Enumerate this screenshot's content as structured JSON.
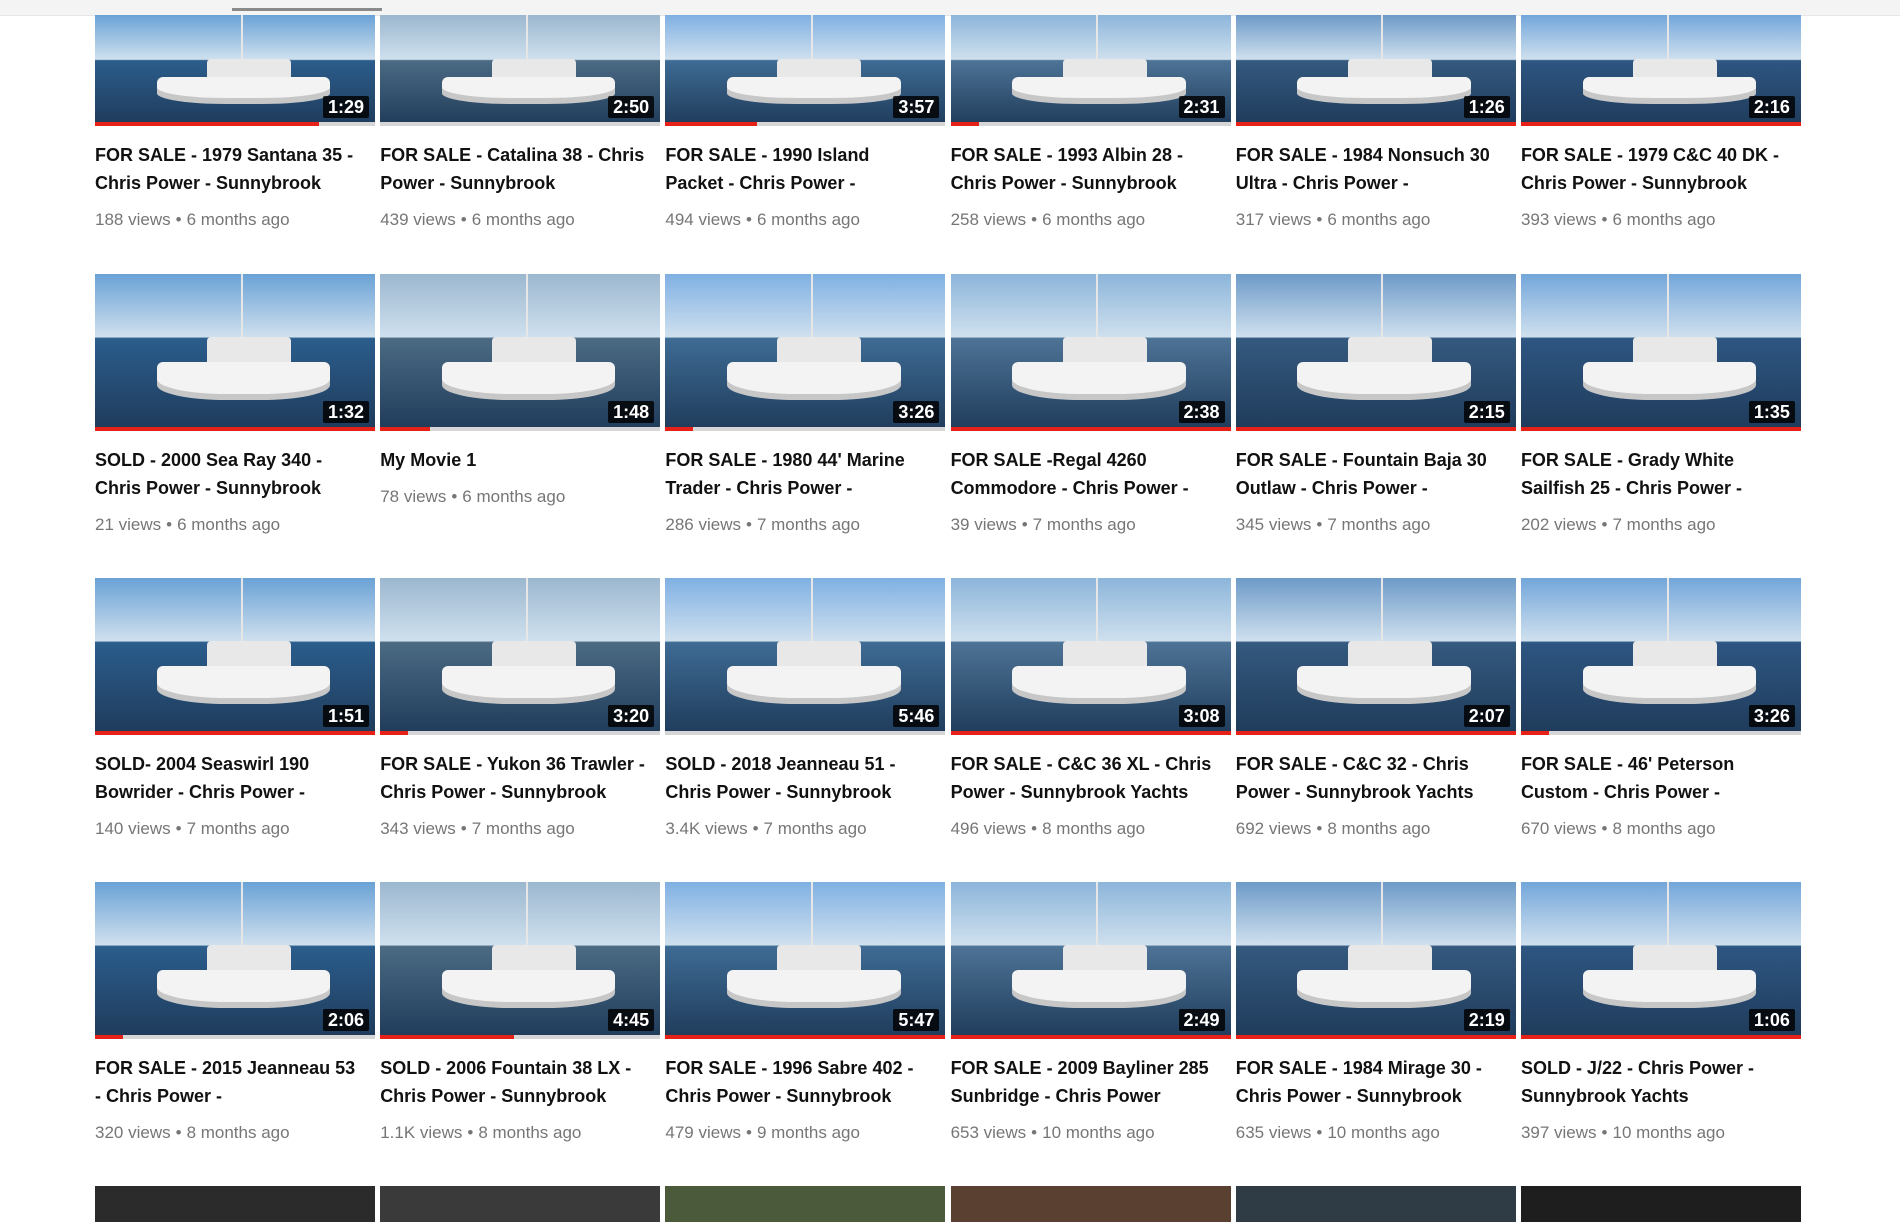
{
  "videos": [
    {
      "title": "FOR SALE - 1979 Santana 35 - Chris Power - Sunnybrook",
      "duration": "1:29",
      "views": "188 views",
      "age": "6 months ago",
      "progress": 0.8
    },
    {
      "title": "FOR SALE - Catalina 38 - Chris Power - Sunnybrook",
      "duration": "2:50",
      "views": "439 views",
      "age": "6 months ago",
      "progress": 0.0
    },
    {
      "title": "FOR SALE - 1990 Island Packet - Chris Power -",
      "duration": "3:57",
      "views": "494 views",
      "age": "6 months ago",
      "progress": 0.33
    },
    {
      "title": "FOR SALE - 1993 Albin 28 - Chris Power - Sunnybrook",
      "duration": "2:31",
      "views": "258 views",
      "age": "6 months ago",
      "progress": 0.1
    },
    {
      "title": "FOR SALE - 1984 Nonsuch 30 Ultra - Chris Power -",
      "duration": "1:26",
      "views": "317 views",
      "age": "6 months ago",
      "progress": 1.0
    },
    {
      "title": "FOR SALE - 1979 C&C 40 DK - Chris Power - Sunnybrook",
      "duration": "2:16",
      "views": "393 views",
      "age": "6 months ago",
      "progress": 1.0
    },
    {
      "title": "SOLD - 2000 Sea Ray 340 - Chris Power - Sunnybrook",
      "duration": "1:32",
      "views": "21 views",
      "age": "6 months ago",
      "progress": 1.0
    },
    {
      "title": "My Movie 1",
      "duration": "1:48",
      "views": "78 views",
      "age": "6 months ago",
      "progress": 0.18
    },
    {
      "title": "FOR SALE - 1980 44' Marine Trader - Chris Power -",
      "duration": "3:26",
      "views": "286 views",
      "age": "7 months ago",
      "progress": 0.1
    },
    {
      "title": "FOR SALE -Regal 4260 Commodore - Chris Power -",
      "duration": "2:38",
      "views": "39 views",
      "age": "7 months ago",
      "progress": 1.0
    },
    {
      "title": "FOR SALE - Fountain Baja 30 Outlaw - Chris Power -",
      "duration": "2:15",
      "views": "345 views",
      "age": "7 months ago",
      "progress": 1.0
    },
    {
      "title": "FOR SALE - Grady White Sailfish 25 - Chris Power -",
      "duration": "1:35",
      "views": "202 views",
      "age": "7 months ago",
      "progress": 1.0
    },
    {
      "title": "SOLD- 2004 Seaswirl 190 Bowrider - Chris Power -",
      "duration": "1:51",
      "views": "140 views",
      "age": "7 months ago",
      "progress": 1.0
    },
    {
      "title": "FOR SALE - Yukon 36 Trawler - Chris Power - Sunnybrook",
      "duration": "3:20",
      "views": "343 views",
      "age": "7 months ago",
      "progress": 0.1
    },
    {
      "title": "SOLD - 2018 Jeanneau 51 - Chris Power - Sunnybrook",
      "duration": "5:46",
      "views": "3.4K views",
      "age": "7 months ago",
      "progress": 0.0
    },
    {
      "title": "FOR SALE - C&C 36 XL - Chris Power - Sunnybrook Yachts",
      "duration": "3:08",
      "views": "496 views",
      "age": "8 months ago",
      "progress": 1.0
    },
    {
      "title": "FOR SALE - C&C 32 - Chris Power - Sunnybrook Yachts",
      "duration": "2:07",
      "views": "692 views",
      "age": "8 months ago",
      "progress": 1.0
    },
    {
      "title": "FOR SALE - 46' Peterson Custom - Chris Power -",
      "duration": "3:26",
      "views": "670 views",
      "age": "8 months ago",
      "progress": 0.1
    },
    {
      "title": "FOR SALE - 2015 Jeanneau 53 - Chris Power -",
      "duration": "2:06",
      "views": "320 views",
      "age": "8 months ago",
      "progress": 0.1
    },
    {
      "title": "SOLD - 2006 Fountain 38 LX - Chris Power - Sunnybrook",
      "duration": "4:45",
      "views": "1.1K views",
      "age": "8 months ago",
      "progress": 0.48
    },
    {
      "title": "FOR SALE - 1996 Sabre 402 - Chris Power - Sunnybrook",
      "duration": "5:47",
      "views": "479 views",
      "age": "9 months ago",
      "progress": 1.0
    },
    {
      "title": "FOR SALE - 2009 Bayliner 285 Sunbridge - Chris Power",
      "duration": "2:49",
      "views": "653 views",
      "age": "10 months ago",
      "progress": 1.0
    },
    {
      "title": "FOR SALE - 1984 Mirage 30 - Chris Power - Sunnybrook",
      "duration": "2:19",
      "views": "635 views",
      "age": "10 months ago",
      "progress": 1.0
    },
    {
      "title": "SOLD - J/22 - Chris Power - Sunnybrook Yachts",
      "duration": "1:06",
      "views": "397 views",
      "age": "10 months ago",
      "progress": 1.0
    }
  ],
  "colors": {
    "progress_watched": "#e62117",
    "meta_text": "#767676",
    "title_text": "#111111"
  }
}
